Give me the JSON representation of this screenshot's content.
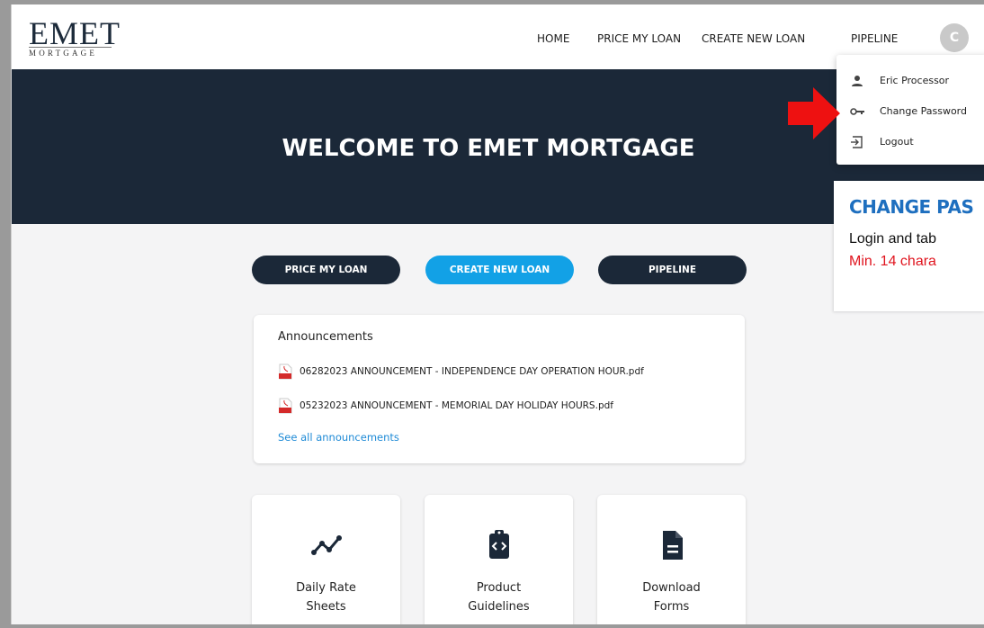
{
  "header": {
    "logo_main": "EMET",
    "logo_sub": "MORTGAGE",
    "nav": [
      "HOME",
      "PRICE MY LOAN",
      "CREATE NEW LOAN",
      "PIPELINE"
    ],
    "avatar_initial": "C"
  },
  "hero": {
    "title": "WELCOME TO EMET MORTGAGE"
  },
  "actions": {
    "price_my_loan": "PRICE MY LOAN",
    "create_new_loan": "CREATE NEW LOAN",
    "pipeline": "PIPELINE"
  },
  "announcements": {
    "title": "Announcements",
    "items": [
      "06282023 ANNOUNCEMENT - INDEPENDENCE DAY OPERATION HOUR.pdf",
      "05232023 ANNOUNCEMENT - MEMORIAL DAY HOLIDAY HOURS.pdf"
    ],
    "see_all": "See all announcements"
  },
  "tiles": [
    {
      "label_1": "Daily Rate",
      "label_2": "Sheets",
      "icon": "trend-line-icon"
    },
    {
      "label_1": "Product",
      "label_2": "Guidelines",
      "icon": "clipboard-code-icon"
    },
    {
      "label_1": "Download",
      "label_2": "Forms",
      "icon": "document-icon"
    }
  ],
  "user_menu": {
    "items": [
      {
        "label": "Eric Processor",
        "icon": "person-icon"
      },
      {
        "label": "Change Password",
        "icon": "key-icon"
      },
      {
        "label": "Logout",
        "icon": "logout-icon"
      }
    ]
  },
  "callout": {
    "title": "CHANGE PAS",
    "line1": "Login and tab",
    "line2": "Min. 14 chara"
  },
  "colors": {
    "navy": "#1b2838",
    "accent_blue": "#12a1e6",
    "link_blue": "#1e8ad6",
    "callout_title": "#1e6fbf",
    "callout_red": "#e0141e",
    "arrow_red": "#ee1111"
  }
}
